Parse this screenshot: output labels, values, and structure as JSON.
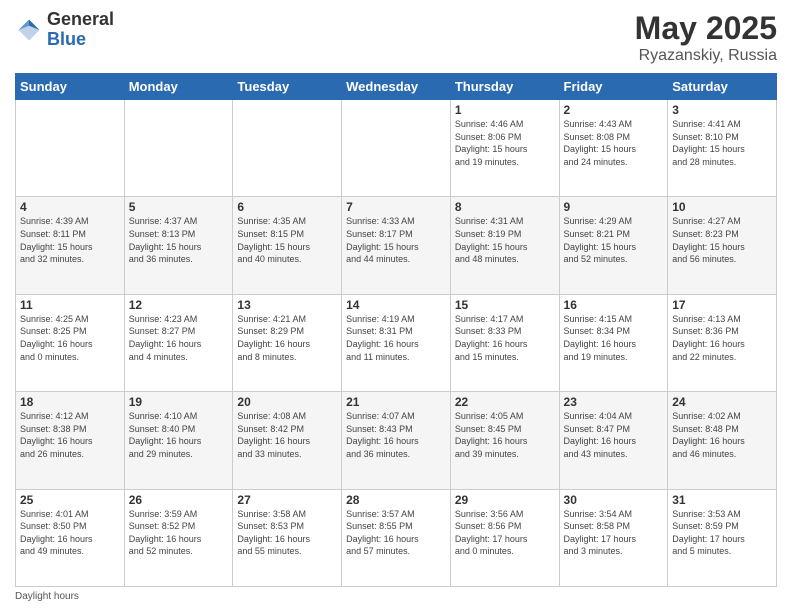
{
  "header": {
    "logo": {
      "general": "General",
      "blue": "Blue"
    },
    "title": "May 2025",
    "location": "Ryazanskiy, Russia"
  },
  "days_of_week": [
    "Sunday",
    "Monday",
    "Tuesday",
    "Wednesday",
    "Thursday",
    "Friday",
    "Saturday"
  ],
  "weeks": [
    [
      {
        "num": "",
        "info": ""
      },
      {
        "num": "",
        "info": ""
      },
      {
        "num": "",
        "info": ""
      },
      {
        "num": "",
        "info": ""
      },
      {
        "num": "1",
        "info": "Sunrise: 4:46 AM\nSunset: 8:06 PM\nDaylight: 15 hours\nand 19 minutes."
      },
      {
        "num": "2",
        "info": "Sunrise: 4:43 AM\nSunset: 8:08 PM\nDaylight: 15 hours\nand 24 minutes."
      },
      {
        "num": "3",
        "info": "Sunrise: 4:41 AM\nSunset: 8:10 PM\nDaylight: 15 hours\nand 28 minutes."
      }
    ],
    [
      {
        "num": "4",
        "info": "Sunrise: 4:39 AM\nSunset: 8:11 PM\nDaylight: 15 hours\nand 32 minutes."
      },
      {
        "num": "5",
        "info": "Sunrise: 4:37 AM\nSunset: 8:13 PM\nDaylight: 15 hours\nand 36 minutes."
      },
      {
        "num": "6",
        "info": "Sunrise: 4:35 AM\nSunset: 8:15 PM\nDaylight: 15 hours\nand 40 minutes."
      },
      {
        "num": "7",
        "info": "Sunrise: 4:33 AM\nSunset: 8:17 PM\nDaylight: 15 hours\nand 44 minutes."
      },
      {
        "num": "8",
        "info": "Sunrise: 4:31 AM\nSunset: 8:19 PM\nDaylight: 15 hours\nand 48 minutes."
      },
      {
        "num": "9",
        "info": "Sunrise: 4:29 AM\nSunset: 8:21 PM\nDaylight: 15 hours\nand 52 minutes."
      },
      {
        "num": "10",
        "info": "Sunrise: 4:27 AM\nSunset: 8:23 PM\nDaylight: 15 hours\nand 56 minutes."
      }
    ],
    [
      {
        "num": "11",
        "info": "Sunrise: 4:25 AM\nSunset: 8:25 PM\nDaylight: 16 hours\nand 0 minutes."
      },
      {
        "num": "12",
        "info": "Sunrise: 4:23 AM\nSunset: 8:27 PM\nDaylight: 16 hours\nand 4 minutes."
      },
      {
        "num": "13",
        "info": "Sunrise: 4:21 AM\nSunset: 8:29 PM\nDaylight: 16 hours\nand 8 minutes."
      },
      {
        "num": "14",
        "info": "Sunrise: 4:19 AM\nSunset: 8:31 PM\nDaylight: 16 hours\nand 11 minutes."
      },
      {
        "num": "15",
        "info": "Sunrise: 4:17 AM\nSunset: 8:33 PM\nDaylight: 16 hours\nand 15 minutes."
      },
      {
        "num": "16",
        "info": "Sunrise: 4:15 AM\nSunset: 8:34 PM\nDaylight: 16 hours\nand 19 minutes."
      },
      {
        "num": "17",
        "info": "Sunrise: 4:13 AM\nSunset: 8:36 PM\nDaylight: 16 hours\nand 22 minutes."
      }
    ],
    [
      {
        "num": "18",
        "info": "Sunrise: 4:12 AM\nSunset: 8:38 PM\nDaylight: 16 hours\nand 26 minutes."
      },
      {
        "num": "19",
        "info": "Sunrise: 4:10 AM\nSunset: 8:40 PM\nDaylight: 16 hours\nand 29 minutes."
      },
      {
        "num": "20",
        "info": "Sunrise: 4:08 AM\nSunset: 8:42 PM\nDaylight: 16 hours\nand 33 minutes."
      },
      {
        "num": "21",
        "info": "Sunrise: 4:07 AM\nSunset: 8:43 PM\nDaylight: 16 hours\nand 36 minutes."
      },
      {
        "num": "22",
        "info": "Sunrise: 4:05 AM\nSunset: 8:45 PM\nDaylight: 16 hours\nand 39 minutes."
      },
      {
        "num": "23",
        "info": "Sunrise: 4:04 AM\nSunset: 8:47 PM\nDaylight: 16 hours\nand 43 minutes."
      },
      {
        "num": "24",
        "info": "Sunrise: 4:02 AM\nSunset: 8:48 PM\nDaylight: 16 hours\nand 46 minutes."
      }
    ],
    [
      {
        "num": "25",
        "info": "Sunrise: 4:01 AM\nSunset: 8:50 PM\nDaylight: 16 hours\nand 49 minutes."
      },
      {
        "num": "26",
        "info": "Sunrise: 3:59 AM\nSunset: 8:52 PM\nDaylight: 16 hours\nand 52 minutes."
      },
      {
        "num": "27",
        "info": "Sunrise: 3:58 AM\nSunset: 8:53 PM\nDaylight: 16 hours\nand 55 minutes."
      },
      {
        "num": "28",
        "info": "Sunrise: 3:57 AM\nSunset: 8:55 PM\nDaylight: 16 hours\nand 57 minutes."
      },
      {
        "num": "29",
        "info": "Sunrise: 3:56 AM\nSunset: 8:56 PM\nDaylight: 17 hours\nand 0 minutes."
      },
      {
        "num": "30",
        "info": "Sunrise: 3:54 AM\nSunset: 8:58 PM\nDaylight: 17 hours\nand 3 minutes."
      },
      {
        "num": "31",
        "info": "Sunrise: 3:53 AM\nSunset: 8:59 PM\nDaylight: 17 hours\nand 5 minutes."
      }
    ]
  ],
  "footer": {
    "daylight_label": "Daylight hours"
  }
}
